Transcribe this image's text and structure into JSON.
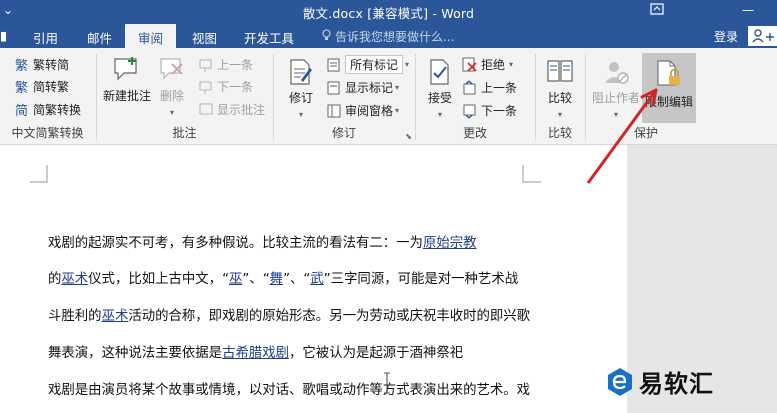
{
  "titlebar": {
    "title": "散文.docx [兼容模式] - Word",
    "qa_icon": "quick-access-caret",
    "ribbon_display_icon": "ribbon-display-options",
    "minimize_glyph": "—"
  },
  "tabs": {
    "items": [
      {
        "label": "引用"
      },
      {
        "label": "邮件"
      },
      {
        "label": "审阅"
      },
      {
        "label": "视图"
      },
      {
        "label": "开发工具"
      }
    ],
    "active_index": 2,
    "tell_me": "告诉我您想要做什么...",
    "login": "登录",
    "share": "Q"
  },
  "ribbon": {
    "chinese_conversion": {
      "label": "中文简繁转换",
      "items": [
        {
          "label": "繁转简",
          "icon": "trad-to-simp-icon"
        },
        {
          "label": "简转繁",
          "icon": "simp-to-trad-icon"
        },
        {
          "label": "简繁转换",
          "icon": "conversion-icon"
        }
      ]
    },
    "comments": {
      "label": "批注",
      "new_comment": "新建批注",
      "delete": "删除",
      "prev": "上一条",
      "next": "下一条",
      "show": "显示批注"
    },
    "tracking": {
      "label": "修订",
      "track_changes": "修订",
      "markup_select": "所有标记",
      "show_markup": "显示标记",
      "reviewing_pane": "审阅窗格"
    },
    "changes": {
      "label": "更改",
      "accept": "接受",
      "reject": "拒绝",
      "prev": "上一条",
      "next": "下一条"
    },
    "compare": {
      "label": "比较",
      "compare": "比较"
    },
    "protect": {
      "label": "保护",
      "block_authors": "阻止作者",
      "restrict_editing": "限制编辑"
    }
  },
  "document": {
    "lines": [
      [
        {
          "t": "戏剧的起源实不可考，有多种假说。比较主流的看法有二：一为"
        },
        {
          "t": "原始宗教",
          "link": true
        }
      ],
      [
        {
          "t": "的"
        },
        {
          "t": "巫术",
          "link": true
        },
        {
          "t": "仪式，比如上古中文，“"
        },
        {
          "t": "巫",
          "link": true
        },
        {
          "t": "”、“"
        },
        {
          "t": "舞",
          "link": true
        },
        {
          "t": "”、“"
        },
        {
          "t": "武",
          "link": true
        },
        {
          "t": "”三字同源，可能是对一种艺术战"
        }
      ],
      [
        {
          "t": "斗胜利的"
        },
        {
          "t": "巫术",
          "link": true
        },
        {
          "t": "活动的合称，即戏剧的原始形态。另一为劳动或庆祝丰收时的即兴歌"
        }
      ],
      [
        {
          "t": "舞表演，这种说法主要依据是"
        },
        {
          "t": "古希腊戏剧",
          "link": true
        },
        {
          "t": "，它被认为是起源于酒神祭祀"
        }
      ],
      [
        {
          "t": "戏剧是由演员将某个故事或情境，以对话、歌唱或动作等方式表演出来的艺术。戏"
        }
      ]
    ]
  },
  "watermark": {
    "text": "易软汇",
    "icon": "e-logo-icon"
  },
  "colors": {
    "brand": "#2b579a",
    "link": "#1f3d8f",
    "arrow": "#d0262a"
  }
}
